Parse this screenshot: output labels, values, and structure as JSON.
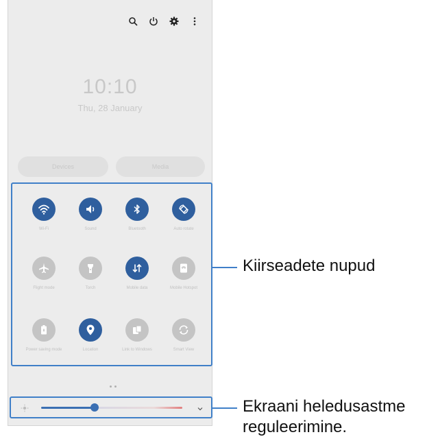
{
  "status_icons": [
    "search-icon",
    "power-icon",
    "gear-icon",
    "more-vert-icon"
  ],
  "lock": {
    "time": "10:10",
    "date": "Thu, 28 January"
  },
  "pills": {
    "left": "Devices",
    "right": "Media"
  },
  "tiles": [
    {
      "icon": "wifi-icon",
      "state": "on",
      "label": "Wi-Fi"
    },
    {
      "icon": "sound-icon",
      "state": "on",
      "label": "Sound"
    },
    {
      "icon": "bluetooth-icon",
      "state": "on",
      "label": "Bluetooth"
    },
    {
      "icon": "auto-rotate-icon",
      "state": "on",
      "label": "Auto rotate"
    },
    {
      "icon": "airplane-icon",
      "state": "off",
      "label": "Flight mode"
    },
    {
      "icon": "torch-icon",
      "state": "off",
      "label": "Torch"
    },
    {
      "icon": "mobile-data-icon",
      "state": "on",
      "label": "Mobile data"
    },
    {
      "icon": "mobile-hotspot-icon",
      "state": "off",
      "label": "Mobile Hotspot"
    },
    {
      "icon": "power-saving-icon",
      "state": "off",
      "label": "Power saving mode"
    },
    {
      "icon": "location-icon",
      "state": "on",
      "label": "Location"
    },
    {
      "icon": "link-to-windows-icon",
      "state": "off",
      "label": "Link to Windows"
    },
    {
      "icon": "smart-view-icon",
      "state": "off",
      "label": "Smart View"
    }
  ],
  "brightness": {
    "level_fraction": 0.38
  },
  "callouts": {
    "quick_settings": "Kiirseadete nupud",
    "brightness_line1": "Ekraani heledusastme",
    "brightness_line2": "reguleerimine."
  },
  "colors": {
    "accent": "#3f7fc8",
    "tile_on": "#2f5f9e",
    "tile_off": "#c4c4c4"
  }
}
